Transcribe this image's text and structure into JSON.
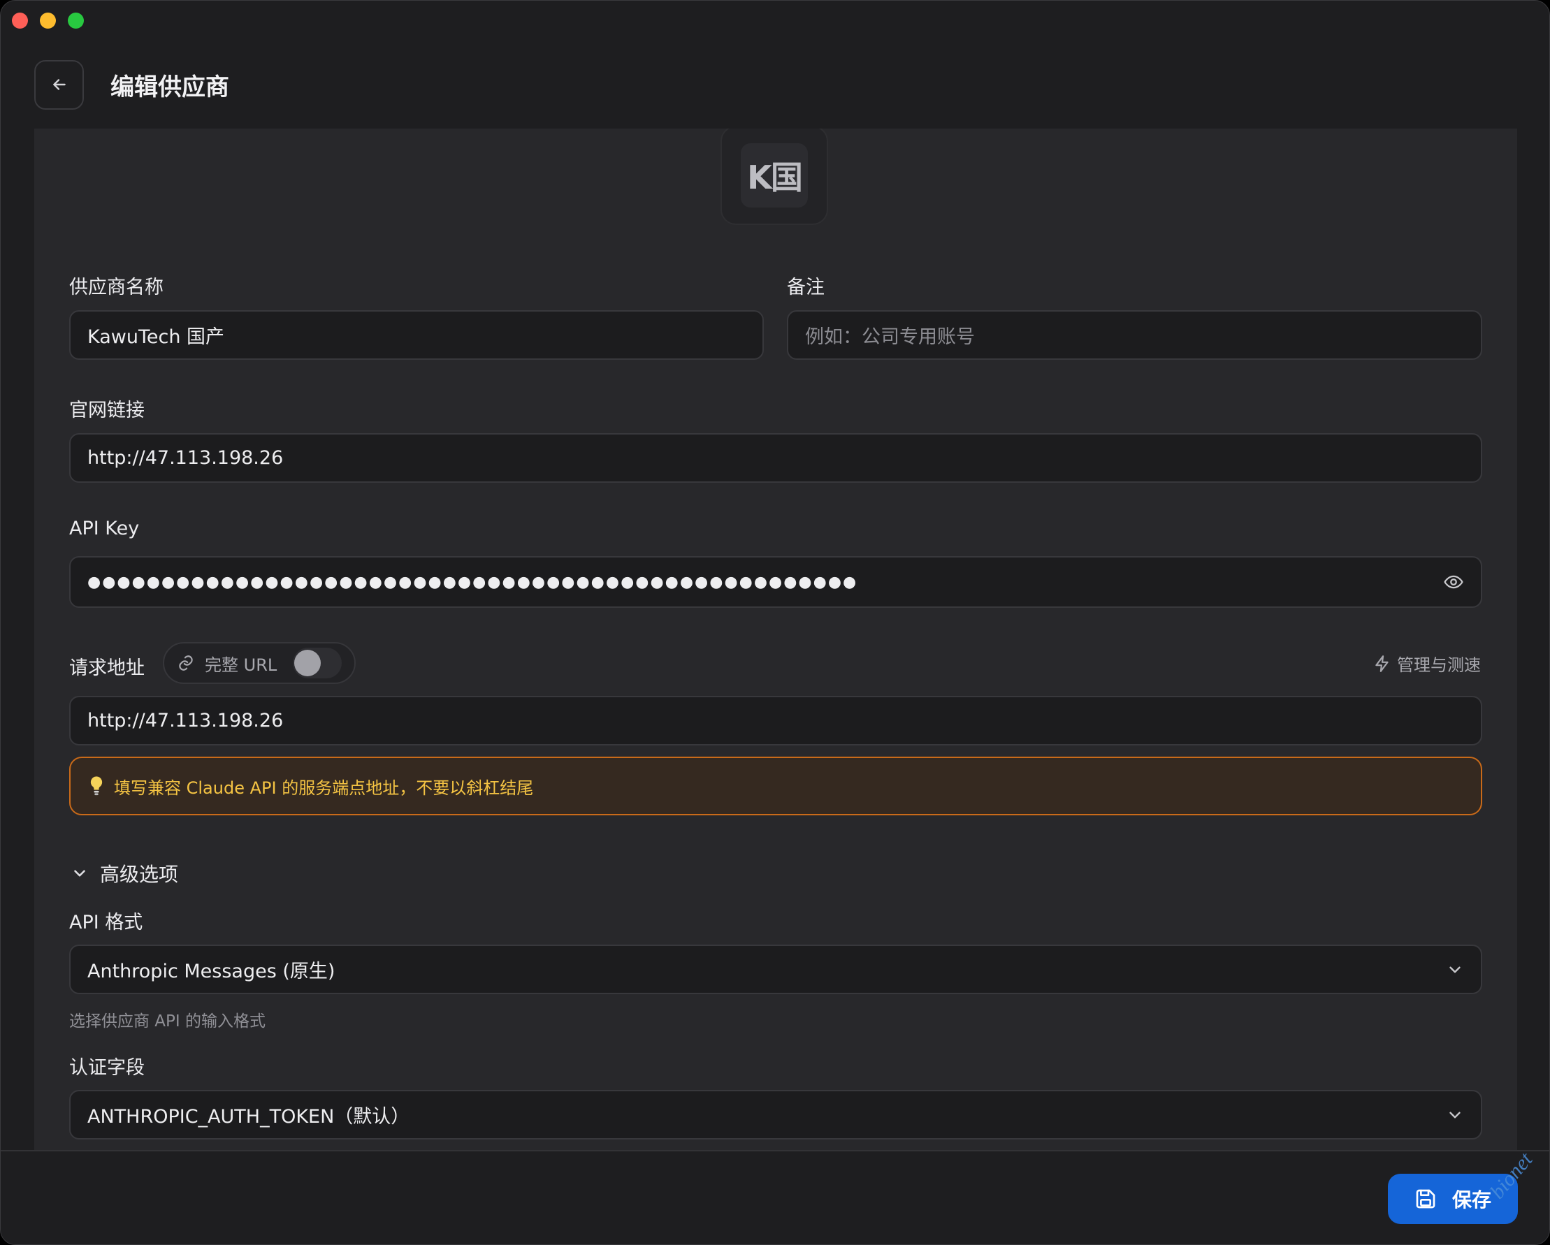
{
  "window": {
    "controls": [
      "close",
      "minimize",
      "maximize"
    ]
  },
  "header": {
    "back_icon": "arrow-left-icon",
    "title": "编辑供应商"
  },
  "logo": {
    "text": "K国"
  },
  "form": {
    "provider_name": {
      "label": "供应商名称",
      "value": "KawuTech 国产"
    },
    "note": {
      "label": "备注",
      "placeholder": "例如：公司专用账号"
    },
    "website": {
      "label": "官网链接",
      "value": "http://47.113.198.26"
    },
    "api_key": {
      "label": "API Key",
      "masked_value": "●●●●●●●●●●●●●●●●●●●●●●●●●●●●●●●●●●●●●●●●●●●●●●●●●●●●",
      "toggle_icon": "eye-icon"
    },
    "request_url": {
      "label": "请求地址",
      "full_url_toggle": {
        "label": "完整 URL",
        "icon": "link-icon",
        "enabled": false
      },
      "manage_link": {
        "label": "管理与测速",
        "icon": "lightning-icon"
      },
      "value": "http://47.113.198.26",
      "tip": {
        "icon": "lightbulb-icon",
        "text": "填写兼容 Claude API 的服务端点地址，不要以斜杠结尾"
      }
    },
    "advanced": {
      "label": "高级选项",
      "expanded": true,
      "api_format": {
        "label": "API 格式",
        "value": "Anthropic Messages (原生)",
        "hint": "选择供应商 API 的输入格式"
      },
      "auth_field": {
        "label": "认证字段",
        "value": "ANTHROPIC_AUTH_TOKEN（默认）"
      }
    }
  },
  "footer": {
    "save_label": "保存",
    "save_icon": "save-icon"
  },
  "watermark": "bionet",
  "colors": {
    "accent": "#1565d8",
    "tip_border": "#c96a19",
    "tip_text": "#f5c443",
    "background": "#1e1e20",
    "panel": "#28282b"
  }
}
